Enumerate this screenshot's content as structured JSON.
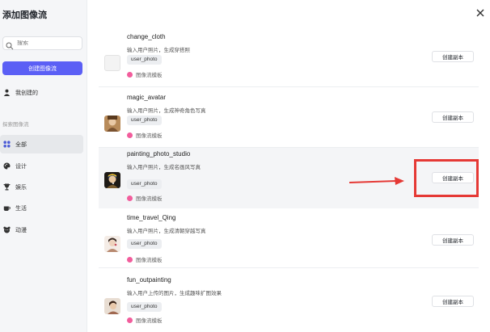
{
  "sidebar": {
    "title": "添加图像流",
    "search_placeholder": "搜索",
    "create_label": "创建图像流",
    "mine_label": "我创建的",
    "explore_label": "探索图像流",
    "categories": [
      {
        "label": "全部",
        "icon": "grid-icon",
        "active": true
      },
      {
        "label": "设计",
        "icon": "palette-icon",
        "active": false
      },
      {
        "label": "娱乐",
        "icon": "trophy-icon",
        "active": false
      },
      {
        "label": "生活",
        "icon": "cup-icon",
        "active": false
      },
      {
        "label": "动漫",
        "icon": "bear-icon",
        "active": false
      }
    ]
  },
  "cards": [
    {
      "name": "change_cloth",
      "desc": "输入用户照片，生成穿搭照",
      "tag": "user_photo",
      "source": "图像流模板",
      "button": "创建副本"
    },
    {
      "name": "magic_avatar",
      "desc": "输入用户照片，生成神奇角色写真",
      "tag": "user_photo",
      "source": "图像流模板",
      "button": "创建副本"
    },
    {
      "name": "painting_photo_studio",
      "desc": "输入用户照片，生成名画风写真",
      "tag": "user_photo",
      "source": "图像流模板",
      "button": "创建副本"
    },
    {
      "name": "time_travel_Qing",
      "desc": "输入用户照片，生成清朝穿越写真",
      "tag": "user_photo",
      "source": "图像流模板",
      "button": "创建副本"
    },
    {
      "name": "fun_outpainting",
      "desc": "输入用户上传的图片，生成趣味扩图效果",
      "tag": "user_photo",
      "source": "图像流模板",
      "button": "创建副本"
    }
  ],
  "close_icon": "close-icon",
  "colors": {
    "accent": "#5b5ff5",
    "highlight": "#e53935",
    "source_dot": "#f25d9c"
  }
}
